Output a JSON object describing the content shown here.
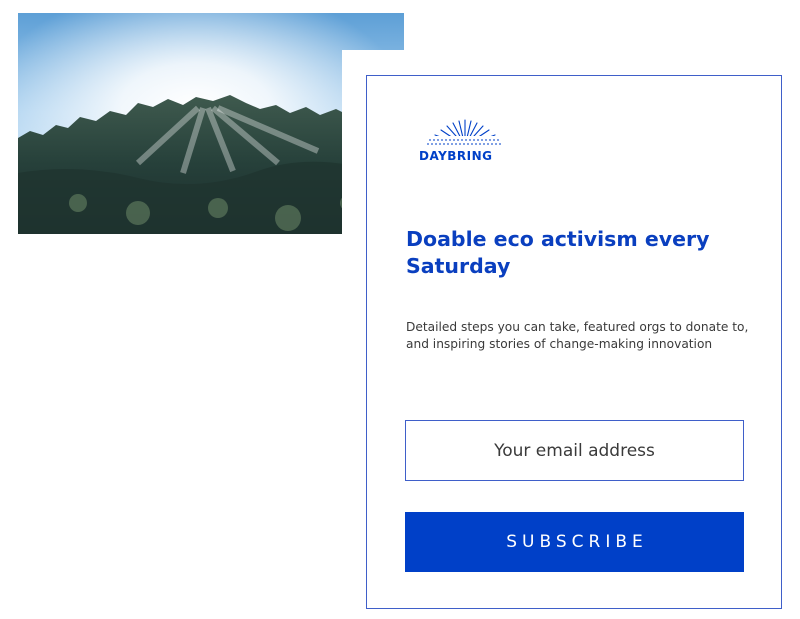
{
  "brand": {
    "name": "DAYBRING",
    "logo_icon": "sunrise-rays-icon",
    "color": "#0040c8"
  },
  "hero_image": {
    "subject": "sun rays over tree-covered hillside"
  },
  "headline": "Doable eco activism every Saturday",
  "description": "Detailed steps you can take, featured orgs to donate to, and inspiring stories of change-making innovation",
  "email": {
    "value": "",
    "placeholder": "Your email address"
  },
  "subscribe": {
    "label": "SUBSCRIBE"
  },
  "colors": {
    "accent": "#0040c8",
    "border": "#3f5fc9",
    "text": "#3a3a3a",
    "background": "#ffffff"
  }
}
